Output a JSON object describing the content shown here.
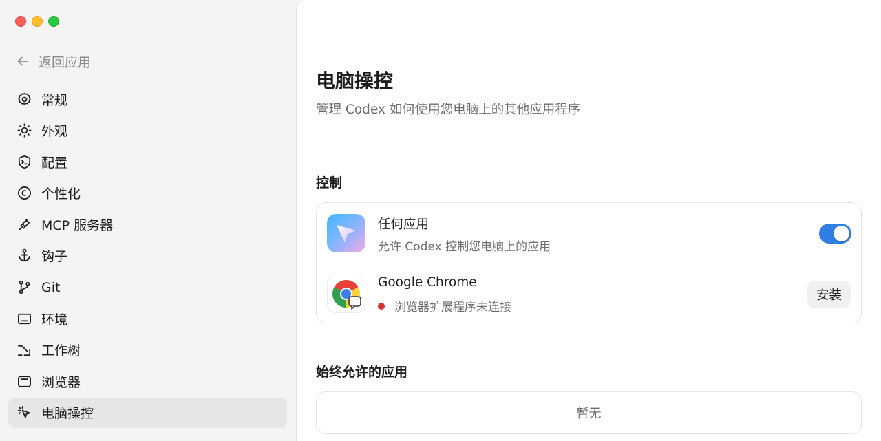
{
  "window": {
    "colors": {
      "close": "#fe5f57",
      "minimize": "#febc2e",
      "zoom": "#28c840"
    }
  },
  "sidebar": {
    "back_label": "返回应用",
    "items": [
      {
        "label": "常规",
        "icon": "gear-icon"
      },
      {
        "label": "外观",
        "icon": "sun-icon"
      },
      {
        "label": "配置",
        "icon": "terminal-shield-icon"
      },
      {
        "label": "个性化",
        "icon": "face-icon"
      },
      {
        "label": "MCP 服务器",
        "icon": "plug-icon"
      },
      {
        "label": "钩子",
        "icon": "anchor-icon"
      },
      {
        "label": "Git",
        "icon": "git-branch-icon"
      },
      {
        "label": "环境",
        "icon": "keyboard-icon"
      },
      {
        "label": "工作树",
        "icon": "arrow-branch-icon"
      },
      {
        "label": "浏览器",
        "icon": "browser-window-icon"
      },
      {
        "label": "电脑操控",
        "icon": "cursor-click-icon",
        "active": true
      }
    ]
  },
  "main": {
    "title": "电脑操控",
    "subtitle": "管理 Codex 如何使用您电脑上的其他应用程序",
    "control_section": {
      "heading": "控制",
      "rows": [
        {
          "title": "任何应用",
          "subtitle": "允许 Codex 控制您电脑上的应用",
          "toggle_on": true,
          "toggle_color": "#2f7fe4"
        },
        {
          "title": "Google Chrome",
          "status": "浏览器扩展程序未连接",
          "status_color": "#d7322d",
          "action_label": "安装"
        }
      ]
    },
    "allowed_section": {
      "heading": "始终允许的应用",
      "empty_text": "暂无"
    }
  }
}
